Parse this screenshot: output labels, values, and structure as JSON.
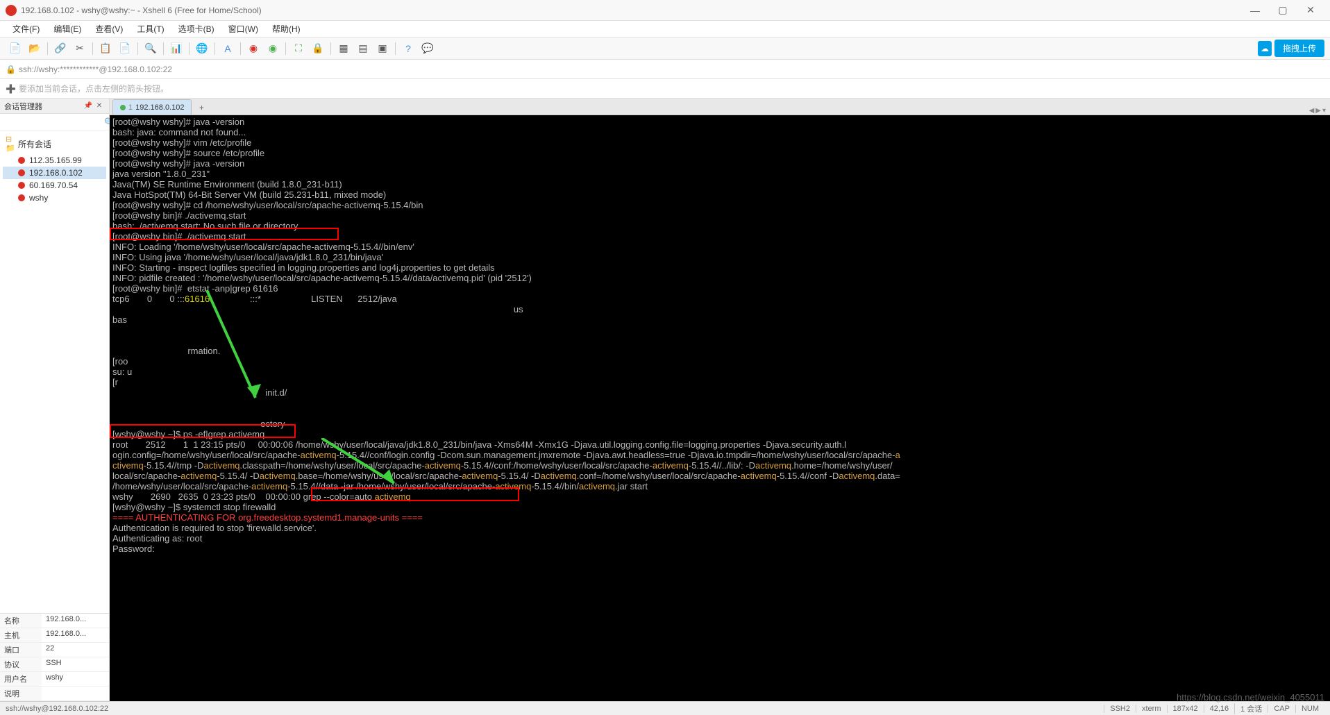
{
  "window": {
    "title": "192.168.0.102 - wshy@wshy:~ - Xshell 6 (Free for Home/School)"
  },
  "menu": {
    "file": "文件(F)",
    "edit": "编辑(E)",
    "view": "查看(V)",
    "tools": "工具(T)",
    "tab": "选项卡(B)",
    "window": "窗口(W)",
    "help": "帮助(H)"
  },
  "toolbar": {
    "upload_label": "拖拽上传"
  },
  "addressbar": {
    "text": "ssh://wshy:************@192.168.0.102:22"
  },
  "hintbar": {
    "text": "要添加当前会话，点击左侧的箭头按钮。"
  },
  "sidebar": {
    "title": "会话管理器",
    "root": "所有会话",
    "items": [
      {
        "label": "112.35.165.99"
      },
      {
        "label": "192.168.0.102"
      },
      {
        "label": "60.169.70.54"
      },
      {
        "label": "wshy"
      }
    ],
    "props": {
      "name_k": "名称",
      "name_v": "192.168.0...",
      "host_k": "主机",
      "host_v": "192.168.0...",
      "port_k": "端口",
      "port_v": "22",
      "proto_k": "协议",
      "proto_v": "SSH",
      "user_k": "用户名",
      "user_v": "wshy",
      "desc_k": "说明",
      "desc_v": ""
    }
  },
  "tabs": {
    "active_num": "1",
    "active_label": "192.168.0.102"
  },
  "terminal_lines": [
    {
      "t": "[root@wshy wshy]# java -version"
    },
    {
      "t": "bash: java: command not found..."
    },
    {
      "t": "[root@wshy wshy]# vim /etc/profile"
    },
    {
      "t": "[root@wshy wshy]# source /etc/profile"
    },
    {
      "t": "[root@wshy wshy]# java -version"
    },
    {
      "t": "java version \"1.8.0_231\""
    },
    {
      "t": "Java(TM) SE Runtime Environment (build 1.8.0_231-b11)"
    },
    {
      "t": "Java HotSpot(TM) 64-Bit Server VM (build 25.231-b11, mixed mode)"
    },
    {
      "t": "[root@wshy wshy]# cd /home/wshy/user/local/src/apache-activemq-5.15.4/bin"
    },
    {
      "t": "[root@wshy bin]# ./activemq.start"
    },
    {
      "t": "bash: ./activemq.start: No such file or directory"
    },
    {
      "t": "[root@wshy bin]# ./activemq start"
    },
    {
      "t": "INFO: Loading '/home/wshy/user/local/src/apache-activemq-5.15.4//bin/env'"
    },
    {
      "t": "INFO: Using java '/home/wshy/user/local/java/jdk1.8.0_231/bin/java'"
    },
    {
      "t": "INFO: Starting - inspect logfiles specified in logging.properties and log4j.properties to get details"
    },
    {
      "t": "INFO: pidfile created : '/home/wshy/user/local/src/apache-activemq-5.15.4//data/activemq.pid' (pid '2512')"
    },
    {
      "t": "[root@wshy bin]#  etstat -anp|grep 61616"
    },
    {
      "segs": [
        {
          "txt": "tcp6       0       0 :::",
          "cls": ""
        },
        {
          "txt": "61616",
          "cls": "hl-yellow"
        },
        {
          "txt": "                :::*                    LISTEN      2512/java",
          "cls": ""
        }
      ]
    },
    {
      "t": "                                                                                                                                                                us"
    },
    {
      "t": "bas"
    },
    {
      "t": " "
    },
    {
      "t": " "
    },
    {
      "t": "                              rmation."
    },
    {
      "t": "[roo"
    },
    {
      "t": "su: u"
    },
    {
      "t": "[r"
    },
    {
      "t": "                                                             init.d/"
    },
    {
      "t": " "
    },
    {
      "t": " "
    },
    {
      "t": "                                                           ectory"
    },
    {
      "t": "[wshy@wshy ~]$ ps -ef|grep activemq"
    },
    {
      "t": "root       2512       1  1 23:15 pts/0     00:00:06 /home/wshy/user/local/java/jdk1.8.0_231/bin/java -Xms64M -Xmx1G -Djava.util.logging.config.file=logging.properties -Djava.security.auth.l"
    },
    {
      "segs": [
        {
          "txt": "ogin.config=/home/wshy/user/local/src/apache-",
          "cls": ""
        },
        {
          "txt": "activemq",
          "cls": "hl-org"
        },
        {
          "txt": "-5.15.4//conf/login.config -Dcom.sun.management.jmxremote -Djava.awt.headless=true -Djava.io.tmpdir=/home/wshy/user/local/src/apache-",
          "cls": ""
        },
        {
          "txt": "a",
          "cls": "hl-org"
        }
      ]
    },
    {
      "segs": [
        {
          "txt": "ctivemq",
          "cls": "hl-org"
        },
        {
          "txt": "-5.15.4//tmp -D",
          "cls": ""
        },
        {
          "txt": "activemq",
          "cls": "hl-org"
        },
        {
          "txt": ".classpath=/home/wshy/user/local/src/apache-",
          "cls": ""
        },
        {
          "txt": "activemq",
          "cls": "hl-org"
        },
        {
          "txt": "-5.15.4//conf:/home/wshy/user/local/src/apache-",
          "cls": ""
        },
        {
          "txt": "activemq",
          "cls": "hl-org"
        },
        {
          "txt": "-5.15.4//../lib/: -D",
          "cls": ""
        },
        {
          "txt": "activemq",
          "cls": "hl-org"
        },
        {
          "txt": ".home=/home/wshy/user/",
          "cls": ""
        }
      ]
    },
    {
      "segs": [
        {
          "txt": "local/src/apache-",
          "cls": ""
        },
        {
          "txt": "activemq",
          "cls": "hl-org"
        },
        {
          "txt": "-5.15.4/ -D",
          "cls": ""
        },
        {
          "txt": "activemq",
          "cls": "hl-org"
        },
        {
          "txt": ".base=/home/wshy/user/local/src/apache-",
          "cls": ""
        },
        {
          "txt": "activemq",
          "cls": "hl-org"
        },
        {
          "txt": "-5.15.4/ -D",
          "cls": ""
        },
        {
          "txt": "activemq",
          "cls": "hl-org"
        },
        {
          "txt": ".conf=/home/wshy/user/local/src/apache-",
          "cls": ""
        },
        {
          "txt": "activemq",
          "cls": "hl-org"
        },
        {
          "txt": "-5.15.4//conf -D",
          "cls": ""
        },
        {
          "txt": "activemq",
          "cls": "hl-org"
        },
        {
          "txt": ".data=",
          "cls": ""
        }
      ]
    },
    {
      "segs": [
        {
          "txt": "/home/wshy/user/local/src/apache-",
          "cls": ""
        },
        {
          "txt": "activemq",
          "cls": "hl-org"
        },
        {
          "txt": "-5.15.4//data -jar /home/wshy/user/local/src/apache-",
          "cls": ""
        },
        {
          "txt": "activemq",
          "cls": "hl-org"
        },
        {
          "txt": "-5.15.4//bin/",
          "cls": ""
        },
        {
          "txt": "activemq",
          "cls": "hl-org"
        },
        {
          "txt": ".jar start",
          "cls": ""
        }
      ]
    },
    {
      "segs": [
        {
          "txt": "wshy       2690   2635  0 23:23 pts/0    00:00:00 grep --color=auto ",
          "cls": ""
        },
        {
          "txt": "activemq",
          "cls": "hl-org"
        }
      ]
    },
    {
      "t": "[wshy@wshy ~]$ systemctl stop firewalld"
    },
    {
      "segs": [
        {
          "txt": "==== AUTHENTICATING FOR org.freedesktop.systemd1.manage-units ====",
          "cls": "hl-red"
        }
      ]
    },
    {
      "t": "Authentication is required to stop 'firewalld.service'."
    },
    {
      "t": "Authenticating as: root"
    },
    {
      "t": "Password: "
    }
  ],
  "statusbar": {
    "left": "ssh://wshy@192.168.0.102:22",
    "seg1": "SSH2",
    "seg2": "xterm",
    "seg3": "187x42",
    "seg4": "42,16",
    "seg5": "1 会话",
    "seg6": "CAP",
    "seg7": "NUM"
  },
  "watermark": "https://blog.csdn.net/weixin_4055011"
}
